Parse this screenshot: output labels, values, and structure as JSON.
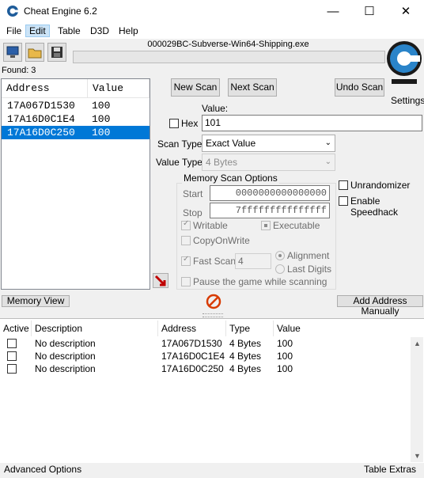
{
  "window": {
    "title": "Cheat Engine 6.2",
    "minimize": "—",
    "maximize": "☐",
    "close": "✕"
  },
  "menu": [
    "File",
    "Edit",
    "Table",
    "D3D",
    "Help"
  ],
  "process_name": "000029BC-Subverse-Win64-Shipping.exe",
  "settings_label": "Settings",
  "found_label": "Found: 3",
  "results": {
    "columns": [
      "Address",
      "Value"
    ],
    "rows": [
      {
        "address": "17A067D1530",
        "value": "100"
      },
      {
        "address": "17A16D0C1E4",
        "value": "100"
      },
      {
        "address": "17A16D0C250",
        "value": "100"
      }
    ],
    "selected_index": 2
  },
  "buttons": {
    "new_scan": "New Scan",
    "next_scan": "Next Scan",
    "undo_scan": "Undo Scan",
    "memory_view": "Memory View",
    "add_address": "Add Address Manually"
  },
  "scan": {
    "value_label": "Value:",
    "hex_label": "Hex",
    "value": "101",
    "scan_type_label": "Scan Type",
    "scan_type": "Exact Value",
    "value_type_label": "Value Type",
    "value_type": "4 Bytes"
  },
  "memory_options": {
    "title": "Memory Scan Options",
    "start_label": "Start",
    "start": "0000000000000000",
    "stop_label": "Stop",
    "stop": "7fffffffffffffff",
    "writable": "Writable",
    "executable": "Executable",
    "copy_on_write": "CopyOnWrite",
    "fast_scan": "Fast Scan",
    "fast_scan_value": "4",
    "alignment": "Alignment",
    "last_digits": "Last Digits",
    "pause": "Pause the game while scanning"
  },
  "side_options": {
    "unrandomizer": "Unrandomizer",
    "speedhack": "Enable Speedhack"
  },
  "address_table": {
    "columns": [
      "Active",
      "Description",
      "Address",
      "Type",
      "Value"
    ],
    "rows": [
      {
        "description": "No description",
        "address": "17A067D1530",
        "type": "4 Bytes",
        "value": "100"
      },
      {
        "description": "No description",
        "address": "17A16D0C1E4",
        "type": "4 Bytes",
        "value": "100"
      },
      {
        "description": "No description",
        "address": "17A16D0C250",
        "type": "4 Bytes",
        "value": "100"
      }
    ]
  },
  "status": {
    "left": "Advanced Options",
    "right": "Table Extras"
  },
  "colors": {
    "selection": "#0078d7",
    "stop_icon": "#d83b01"
  }
}
